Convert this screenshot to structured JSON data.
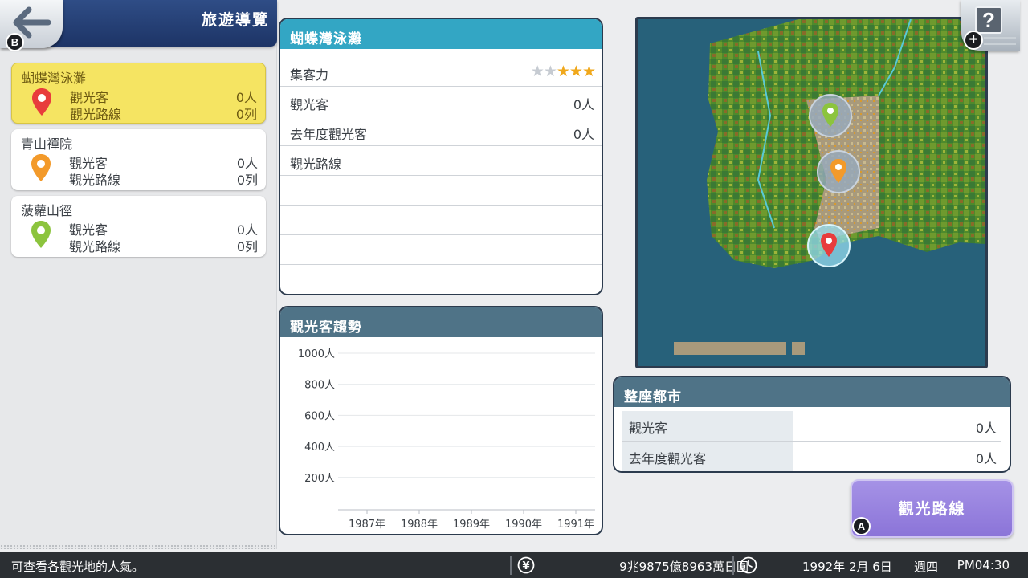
{
  "header": {
    "title": "旅遊導覽",
    "back_badge": "B"
  },
  "spots": [
    {
      "name": "蝴蝶灣泳灘",
      "pin_color": "#e83c3c",
      "visitors_label": "觀光客",
      "visitors_value": "0人",
      "routes_label": "觀光路線",
      "routes_value": "0列"
    },
    {
      "name": "青山禪院",
      "pin_color": "#f39a2a",
      "visitors_label": "觀光客",
      "visitors_value": "0人",
      "routes_label": "觀光路線",
      "routes_value": "0列"
    },
    {
      "name": "菠蘿山徑",
      "pin_color": "#8cc43e",
      "visitors_label": "觀光客",
      "visitors_value": "0人",
      "routes_label": "觀光路線",
      "routes_value": "0列"
    }
  ],
  "info_panel": {
    "title": "蝴蝶灣泳灘",
    "attraction_label": "集客力",
    "attraction_stars": 3,
    "attraction_max": 5,
    "visitors_label": "觀光客",
    "visitors_value": "0人",
    "last_year_label": "去年度觀光客",
    "last_year_value": "0人",
    "routes_label": "觀光路線"
  },
  "trend_panel": {
    "title": "觀光客趨勢"
  },
  "chart_data": {
    "type": "line",
    "title": "觀光客趨勢",
    "x": [
      "1987年",
      "1988年",
      "1989年",
      "1990年",
      "1991年"
    ],
    "y_ticks": [
      "1000人",
      "800人",
      "600人",
      "400人",
      "200人"
    ],
    "ylim": [
      0,
      1000
    ],
    "grid": true,
    "series": []
  },
  "map": {
    "sea_color": "#27617a",
    "markers": [
      {
        "pin_color": "#8cc43e"
      },
      {
        "pin_color": "#f39a2a"
      },
      {
        "pin_color": "#e83c3c"
      }
    ]
  },
  "help_button": {
    "icon": "?",
    "badge": "+"
  },
  "city_panel": {
    "title": "整座都市",
    "visitors_label": "觀光客",
    "visitors_value": "0人",
    "last_year_label": "去年度觀光客",
    "last_year_value": "0人"
  },
  "route_button": {
    "label": "觀光路線",
    "badge": "A"
  },
  "status_bar": {
    "message": "可查看各觀光地的人氣。",
    "money_icon": "¥",
    "money": "9兆9875億8963萬日圓",
    "date": "1992年 2月 6日",
    "weekday": "週四",
    "time": "PM04:30"
  }
}
